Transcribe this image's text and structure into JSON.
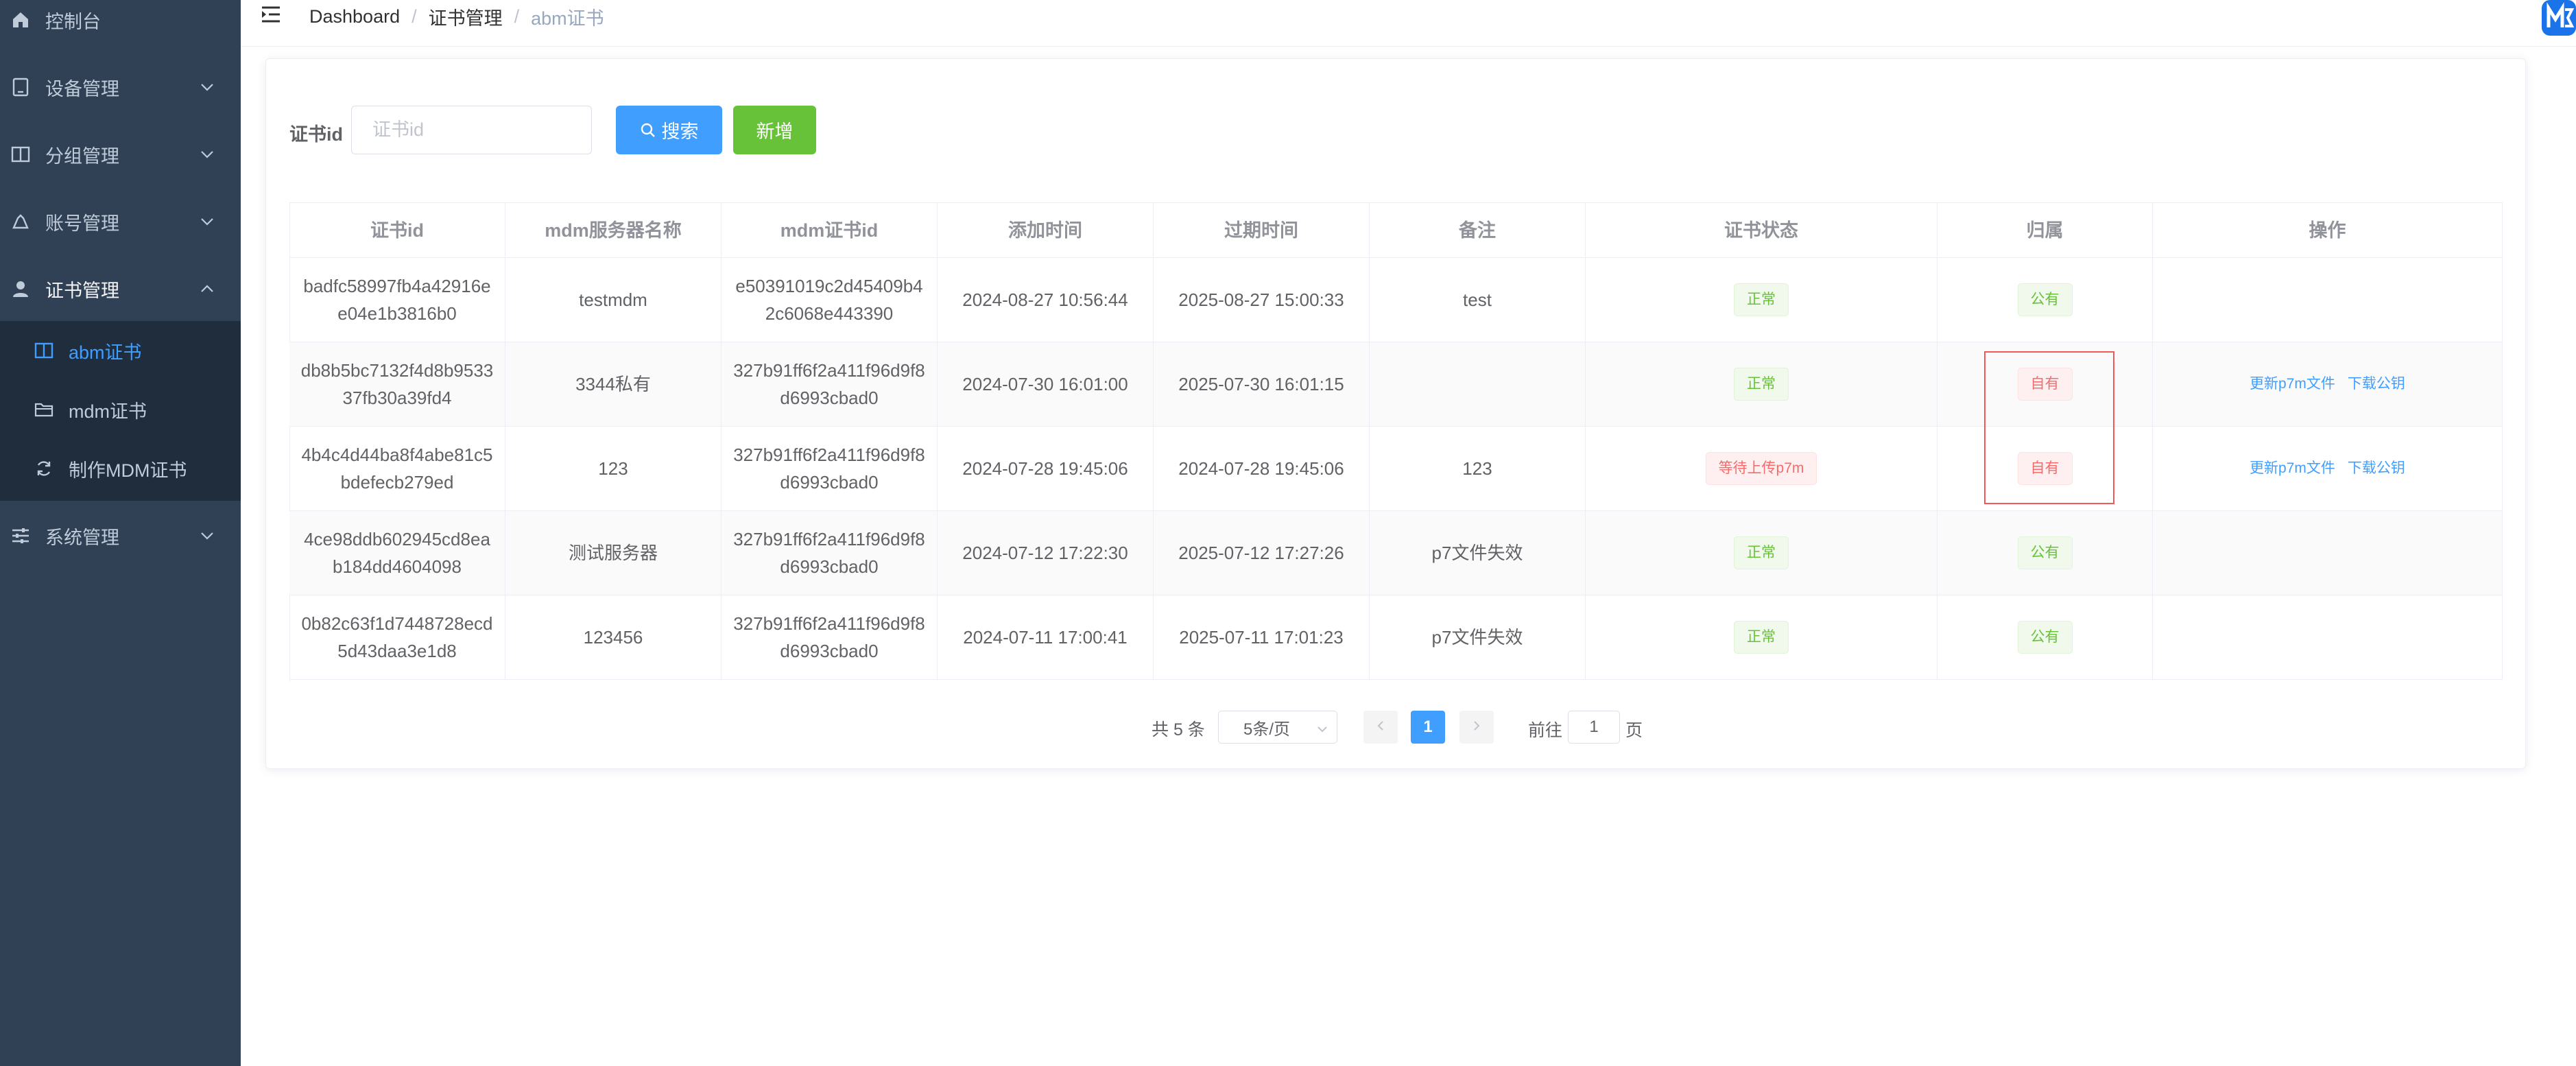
{
  "sidebar": {
    "items": [
      {
        "label": "控制台",
        "icon": "home-icon"
      },
      {
        "label": "设备管理",
        "icon": "device-icon"
      },
      {
        "label": "分组管理",
        "icon": "book-icon"
      },
      {
        "label": "账号管理",
        "icon": "account-icon"
      },
      {
        "label": "证书管理",
        "icon": "user-icon"
      },
      {
        "label": "系统管理",
        "icon": "sliders-icon"
      }
    ],
    "subitems": [
      {
        "label": "abm证书",
        "icon": "book-icon"
      },
      {
        "label": "mdm证书",
        "icon": "folder-icon"
      },
      {
        "label": "制作MDM证书",
        "icon": "refresh-icon"
      }
    ]
  },
  "breadcrumb": [
    "Dashboard",
    "证书管理",
    "abm证书"
  ],
  "filter": {
    "label": "证书id",
    "placeholder": "证书id",
    "value": ""
  },
  "buttons": {
    "search": "搜索",
    "add": "新增"
  },
  "table": {
    "headers": [
      "证书id",
      "mdm服务器名称",
      "mdm证书id",
      "添加时间",
      "过期时间",
      "备注",
      "证书状态",
      "归属",
      "操作"
    ],
    "rows": [
      {
        "cert_id": "badfc58997fb4a42916ee04e1b3816b0",
        "server": "testmdm",
        "mdm_id": "e50391019c2d45409b42c6068e443390",
        "added": "2024-08-27 10:56:44",
        "expires": "2025-08-27 15:00:33",
        "note": "test",
        "status": "正常",
        "owner": "公有",
        "actions": []
      },
      {
        "cert_id": "db8b5bc7132f4d8b953337fb30a39fd4",
        "server": "3344私有",
        "mdm_id": "327b91ff6f2a411f96d9f8d6993cbad0",
        "added": "2024-07-30 16:01:00",
        "expires": "2025-07-30 16:01:15",
        "note": "",
        "status": "正常",
        "owner": "自有",
        "actions": [
          "更新p7m文件",
          "下载公钥"
        ]
      },
      {
        "cert_id": "4b4c4d44ba8f4abe81c5bdefecb279ed",
        "server": "123",
        "mdm_id": "327b91ff6f2a411f96d9f8d6993cbad0",
        "added": "2024-07-28 19:45:06",
        "expires": "2024-07-28 19:45:06",
        "note": "123",
        "status": "等待上传p7m",
        "owner": "自有",
        "actions": [
          "更新p7m文件",
          "下载公钥"
        ]
      },
      {
        "cert_id": "4ce98ddb602945cd8eab184dd4604098",
        "server": "测试服务器",
        "mdm_id": "327b91ff6f2a411f96d9f8d6993cbad0",
        "added": "2024-07-12 17:22:30",
        "expires": "2025-07-12 17:27:26",
        "note": "p7文件失效",
        "status": "正常",
        "owner": "公有",
        "actions": []
      },
      {
        "cert_id": "0b82c63f1d7448728ecd5d43daa3e1d8",
        "server": "123456",
        "mdm_id": "327b91ff6f2a411f96d9f8d6993cbad0",
        "added": "2024-07-11 17:00:41",
        "expires": "2025-07-11 17:01:23",
        "note": "p7文件失效",
        "status": "正常",
        "owner": "公有",
        "actions": []
      }
    ]
  },
  "pagination": {
    "total": "共 5 条",
    "page_size": "5条/页",
    "current": "1",
    "goto_label": "前往",
    "goto_value": "1",
    "page_suffix": "页"
  },
  "colors": {
    "sidebar_bg": "#304156",
    "submenu_bg": "#1f2d3d",
    "primary": "#409eff",
    "success": "#67c23a",
    "danger": "#f56c6c",
    "highlight_box": "#f25959"
  }
}
